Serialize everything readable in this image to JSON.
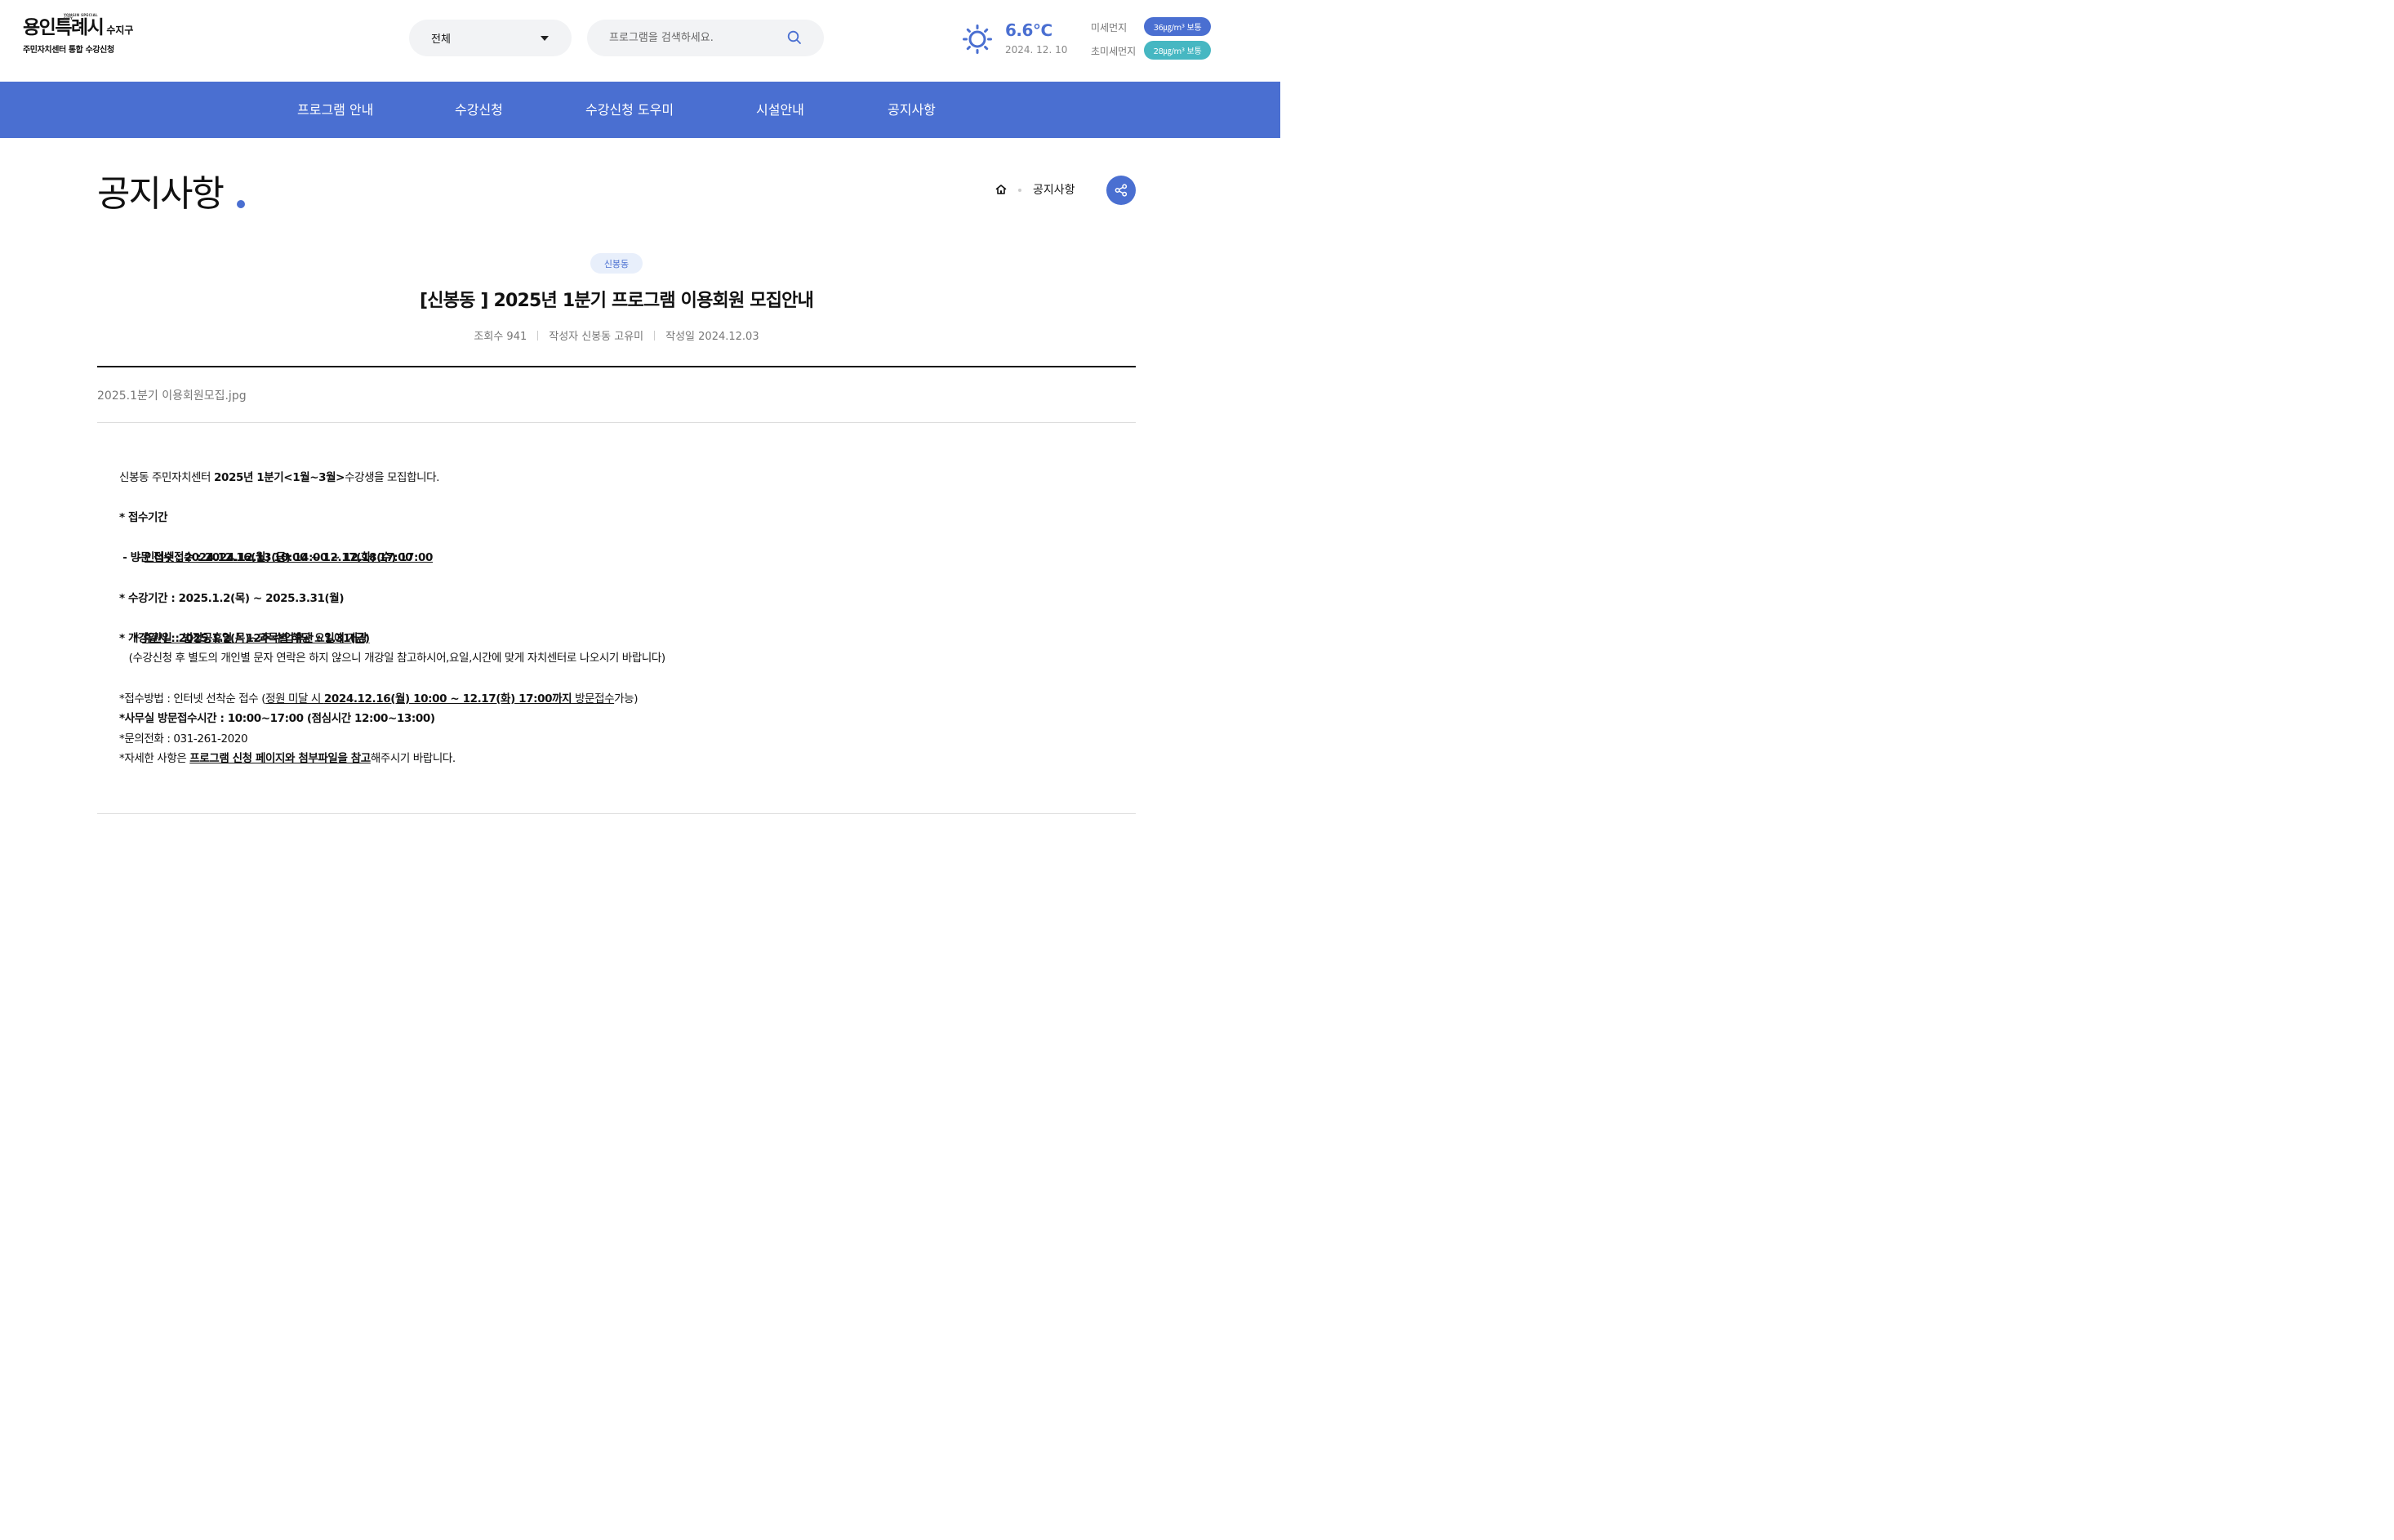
{
  "header": {
    "logo": {
      "city": "용인특례시",
      "city_en": "YONGIN SPECIAL CITY",
      "district": "수지구",
      "subtitle": "주민자치센터 통합 수강신청"
    },
    "category_select": {
      "value": "전체"
    },
    "search": {
      "placeholder": "프로그램을 검색하세요."
    },
    "weather": {
      "icon": "sun-icon",
      "temperature": "6.6℃",
      "date": "2024. 12. 10",
      "fine_dust_label": "미세먼지",
      "fine_dust_value": "36㎍/m³ 보통",
      "ultra_fine_dust_label": "초미세먼지",
      "ultra_fine_dust_value": "28㎍/m³ 보통"
    }
  },
  "nav": {
    "items": [
      {
        "label": "프로그램 안내"
      },
      {
        "label": "수강신청"
      },
      {
        "label": "수강신청 도우미"
      },
      {
        "label": "시설안내"
      },
      {
        "label": "공지사항"
      }
    ]
  },
  "page": {
    "title": "공지사항",
    "breadcrumb": {
      "home_icon": "home-icon",
      "current": "공지사항"
    },
    "share_icon": "share-icon"
  },
  "post": {
    "category": "신봉동",
    "title": "[신봉동 ] 2025년 1분기 프로그램 이용회원 모집안내",
    "meta": {
      "views": "조회수 941",
      "author": "작성자 신봉동 고유미",
      "date": "작성일 2024.12.03"
    },
    "attachment": "2025.1분기 이용회원모집.jpg",
    "body": {
      "l1_a": "신봉동 주민자치센터 ",
      "l1_b": "2025년 1분기<1월~3월>",
      "l1_c": "수강생을 모집합니다.",
      "l2": "* 접수기간",
      "l3_a": " - ",
      "l3_b": "인터넷접수 : 2024.12.13(금) 14:00 ~ 12.18(수) 17:00",
      "l4": " - 방문 접수 : 2024.12.16(월) 10:00 ~ 12.17(화) 17:00",
      "l5": "* 수강기간 : 2025.1.2(목) ~ 2025.3.31(월)",
      "l6_a": "* ",
      "l6_b": "휴관일 : 법정공휴일 /  12주 수업휴관 : 1.31(금)",
      "l7": "* 개강일시 : 2025.1.2(목)~과목별 해당 요일에 개강",
      "l8": "   (수강신청 후 별도의 개인별 문자 연락은 하지 않으니 개강일 참고하시어,요일,시간에 맞게 자치센터로 나오시기 바랍니다)",
      "l9_a": "*접수방법 : 인터넷 선착순 접수 (",
      "l9_b": "정원 미달 시 ",
      "l9_c": "2024.12.16(월) 10:00 ~ 12.17(화) 17:00까지",
      "l9_d": " 방문접수",
      "l9_e": "가능)",
      "l10": "*사무실 방문접수시간 : 10:00~17:00 (점심시간 12:00~13:00)",
      "l11": "*문의전화 : 031-261-2020",
      "l12_a": "*자세한 사항은 ",
      "l12_b": "프로그램 신청 페이지와 첨부파일을 참고",
      "l12_c": "해주시기 바랍니다."
    }
  },
  "colors": {
    "primary": "#4a6fd1",
    "teal": "#46b7c2",
    "category_bg": "#e8effb"
  }
}
